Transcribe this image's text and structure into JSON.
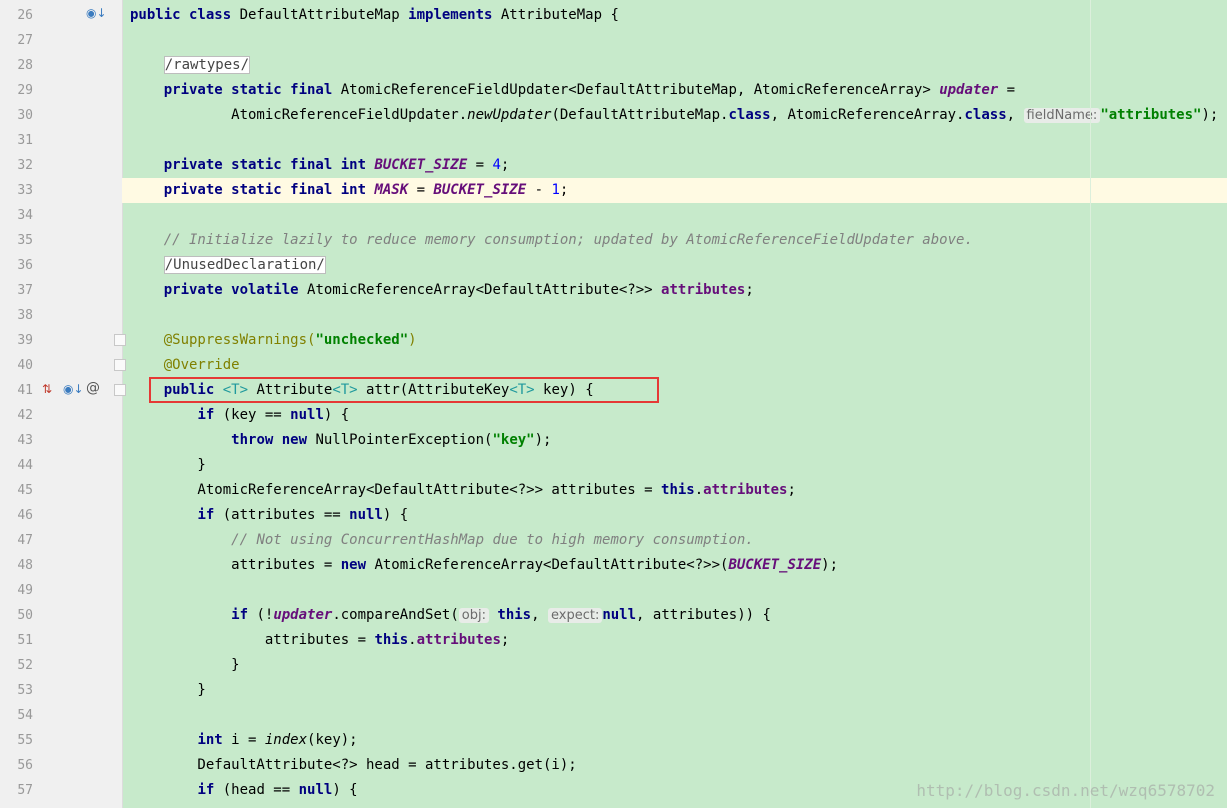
{
  "editor": {
    "lines": [
      {
        "num": "26",
        "tokens": [
          [
            "kw",
            "public class "
          ],
          [
            "",
            "DefaultAttributeMap "
          ],
          [
            "kw",
            "implements "
          ],
          [
            "",
            "AttributeMap {"
          ]
        ]
      },
      {
        "num": "27",
        "tokens": []
      },
      {
        "num": "28",
        "tokens": [
          [
            "",
            "    "
          ],
          [
            "fold",
            "/rawtypes/"
          ]
        ]
      },
      {
        "num": "29",
        "tokens": [
          [
            "",
            "    "
          ],
          [
            "kw",
            "private static final "
          ],
          [
            "",
            "AtomicReferenceFieldUpdater<DefaultAttributeMap, AtomicReferenceArray> "
          ],
          [
            "sfld",
            "updater"
          ],
          [
            "",
            " ="
          ]
        ]
      },
      {
        "num": "30",
        "tokens": [
          [
            "",
            "            AtomicReferenceFieldUpdater."
          ],
          [
            "ital",
            "newUpdater"
          ],
          [
            "",
            "(DefaultAttributeMap."
          ],
          [
            "kw",
            "class"
          ],
          [
            "",
            ", AtomicReferenceArray."
          ],
          [
            "kw",
            "class"
          ],
          [
            "",
            ", "
          ],
          [
            "hint",
            "fieldName:"
          ],
          [
            "str",
            "\"attributes\""
          ],
          [
            "",
            ");"
          ]
        ]
      },
      {
        "num": "31",
        "tokens": []
      },
      {
        "num": "32",
        "tokens": [
          [
            "",
            "    "
          ],
          [
            "kw",
            "private static final int "
          ],
          [
            "sfld",
            "BUCKET_SIZE"
          ],
          [
            "",
            " = "
          ],
          [
            "num",
            "4"
          ],
          [
            "",
            ";"
          ]
        ]
      },
      {
        "num": "33",
        "tokens": [
          [
            "",
            "    "
          ],
          [
            "kw",
            "private static final int "
          ],
          [
            "sfld",
            "MASK"
          ],
          [
            "",
            " = "
          ],
          [
            "sfld",
            "BUCKET_SIZE"
          ],
          [
            "",
            " - "
          ],
          [
            "num",
            "1"
          ],
          [
            "",
            ";"
          ]
        ],
        "highlight": true
      },
      {
        "num": "34",
        "tokens": []
      },
      {
        "num": "35",
        "tokens": [
          [
            "",
            "    "
          ],
          [
            "cmt",
            "// Initialize lazily to reduce memory consumption; updated by AtomicReferenceFieldUpdater above."
          ]
        ]
      },
      {
        "num": "36",
        "tokens": [
          [
            "",
            "    "
          ],
          [
            "fold",
            "/UnusedDeclaration/"
          ]
        ]
      },
      {
        "num": "37",
        "tokens": [
          [
            "",
            "    "
          ],
          [
            "kw",
            "private volatile "
          ],
          [
            "",
            "AtomicReferenceArray<DefaultAttribute<?>> "
          ],
          [
            "fld",
            "attributes"
          ],
          [
            "",
            ";"
          ]
        ]
      },
      {
        "num": "38",
        "tokens": []
      },
      {
        "num": "39",
        "tokens": [
          [
            "",
            "    "
          ],
          [
            "ann",
            "@SuppressWarnings("
          ],
          [
            "str",
            "\"unchecked\""
          ],
          [
            "ann",
            ")"
          ]
        ]
      },
      {
        "num": "40",
        "tokens": [
          [
            "",
            "    "
          ],
          [
            "ann",
            "@Override"
          ]
        ]
      },
      {
        "num": "41",
        "tokens": [
          [
            "",
            "    "
          ],
          [
            "kw",
            "public "
          ],
          [
            "tp",
            "<T> "
          ],
          [
            "",
            "Attribute"
          ],
          [
            "tp",
            "<T> "
          ],
          [
            "",
            "attr(AttributeKey"
          ],
          [
            "tp",
            "<T> "
          ],
          [
            "",
            "key) {"
          ]
        ]
      },
      {
        "num": "42",
        "tokens": [
          [
            "",
            "        "
          ],
          [
            "kw",
            "if "
          ],
          [
            "",
            "(key == "
          ],
          [
            "kw",
            "null"
          ],
          [
            "",
            ") {"
          ]
        ]
      },
      {
        "num": "43",
        "tokens": [
          [
            "",
            "            "
          ],
          [
            "kw",
            "throw new "
          ],
          [
            "",
            "NullPointerException("
          ],
          [
            "str",
            "\"key\""
          ],
          [
            "",
            ");"
          ]
        ]
      },
      {
        "num": "44",
        "tokens": [
          [
            "",
            "        }"
          ]
        ]
      },
      {
        "num": "45",
        "tokens": [
          [
            "",
            "        AtomicReferenceArray<DefaultAttribute<?>> attributes = "
          ],
          [
            "kw",
            "this"
          ],
          [
            "",
            "."
          ],
          [
            "fld",
            "attributes"
          ],
          [
            "",
            ";"
          ]
        ]
      },
      {
        "num": "46",
        "tokens": [
          [
            "",
            "        "
          ],
          [
            "kw",
            "if "
          ],
          [
            "",
            "(attributes == "
          ],
          [
            "kw",
            "null"
          ],
          [
            "",
            ") {"
          ]
        ]
      },
      {
        "num": "47",
        "tokens": [
          [
            "",
            "            "
          ],
          [
            "cmt",
            "// Not using ConcurrentHashMap due to high memory consumption."
          ]
        ]
      },
      {
        "num": "48",
        "tokens": [
          [
            "",
            "            attributes = "
          ],
          [
            "kw",
            "new "
          ],
          [
            "",
            "AtomicReferenceArray<DefaultAttribute<?>>("
          ],
          [
            "sfld",
            "BUCKET_SIZE"
          ],
          [
            "",
            ");"
          ]
        ]
      },
      {
        "num": "49",
        "tokens": []
      },
      {
        "num": "50",
        "tokens": [
          [
            "",
            "            "
          ],
          [
            "kw",
            "if "
          ],
          [
            "",
            "(!"
          ],
          [
            "sfld",
            "updater"
          ],
          [
            "",
            ".compareAndSet("
          ],
          [
            "hint",
            "obj:"
          ],
          [
            "kw",
            " this"
          ],
          [
            "",
            ", "
          ],
          [
            "hint",
            "expect:"
          ],
          [
            "kw",
            "null"
          ],
          [
            "",
            ", attributes)) {"
          ]
        ]
      },
      {
        "num": "51",
        "tokens": [
          [
            "",
            "                attributes = "
          ],
          [
            "kw",
            "this"
          ],
          [
            "",
            "."
          ],
          [
            "fld",
            "attributes"
          ],
          [
            "",
            ";"
          ]
        ]
      },
      {
        "num": "52",
        "tokens": [
          [
            "",
            "            }"
          ]
        ]
      },
      {
        "num": "53",
        "tokens": [
          [
            "",
            "        }"
          ]
        ]
      },
      {
        "num": "54",
        "tokens": []
      },
      {
        "num": "55",
        "tokens": [
          [
            "",
            "        "
          ],
          [
            "kw",
            "int "
          ],
          [
            "",
            "i = "
          ],
          [
            "ital",
            "index"
          ],
          [
            "",
            "(key);"
          ]
        ]
      },
      {
        "num": "56",
        "tokens": [
          [
            "",
            "        DefaultAttribute<?> head = attributes.get(i);"
          ]
        ]
      },
      {
        "num": "57",
        "tokens": [
          [
            "",
            "        "
          ],
          [
            "kw",
            "if "
          ],
          [
            "",
            "(head == "
          ],
          [
            "kw",
            "null"
          ],
          [
            "",
            ") {"
          ]
        ]
      }
    ]
  },
  "gutter_icons": {
    "line26": "implements-interface-icon",
    "line41": [
      "override-up-icon",
      "implemented-icon",
      "annotation-at-icon"
    ],
    "at_symbol": "@"
  },
  "watermark": "http://blog.csdn.net/wzq6578702",
  "colors": {
    "background": "#c7eacb",
    "current_line": "#fffae3",
    "highlight_box": "#e53935",
    "keyword": "#000080",
    "string": "#008000",
    "field": "#660e7a",
    "comment": "#808080",
    "annotation": "#808000",
    "type_param": "#20999d"
  }
}
